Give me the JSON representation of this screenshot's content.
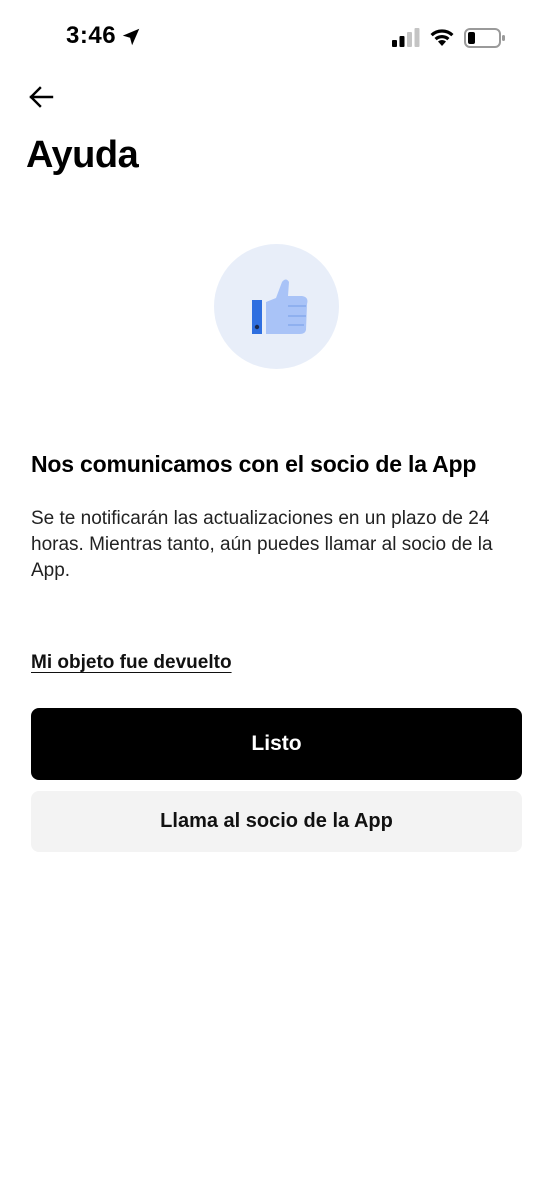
{
  "status_bar": {
    "time": "3:46",
    "icons": [
      "location-arrow-icon",
      "cell-signal-icon",
      "wifi-icon",
      "battery-icon"
    ]
  },
  "header": {
    "back_icon": "arrow-left-icon",
    "title": "Ayuda"
  },
  "illustration": {
    "icon": "thumbs-up-icon",
    "colors": {
      "circle": "#e8eef9",
      "thumb": "#a9c3f7",
      "cuff": "#2f6fe0"
    }
  },
  "content": {
    "heading": "Nos comunicamos con el socio de la App",
    "body": "Se te notificarán las actualizaciones en un plazo de 24 horas. Mientras tanto, aún puedes llamar al socio de la App."
  },
  "actions": {
    "link_returned": "Mi objeto fue devuelto",
    "done_label": "Listo",
    "call_label": "Llama al socio de la App"
  }
}
